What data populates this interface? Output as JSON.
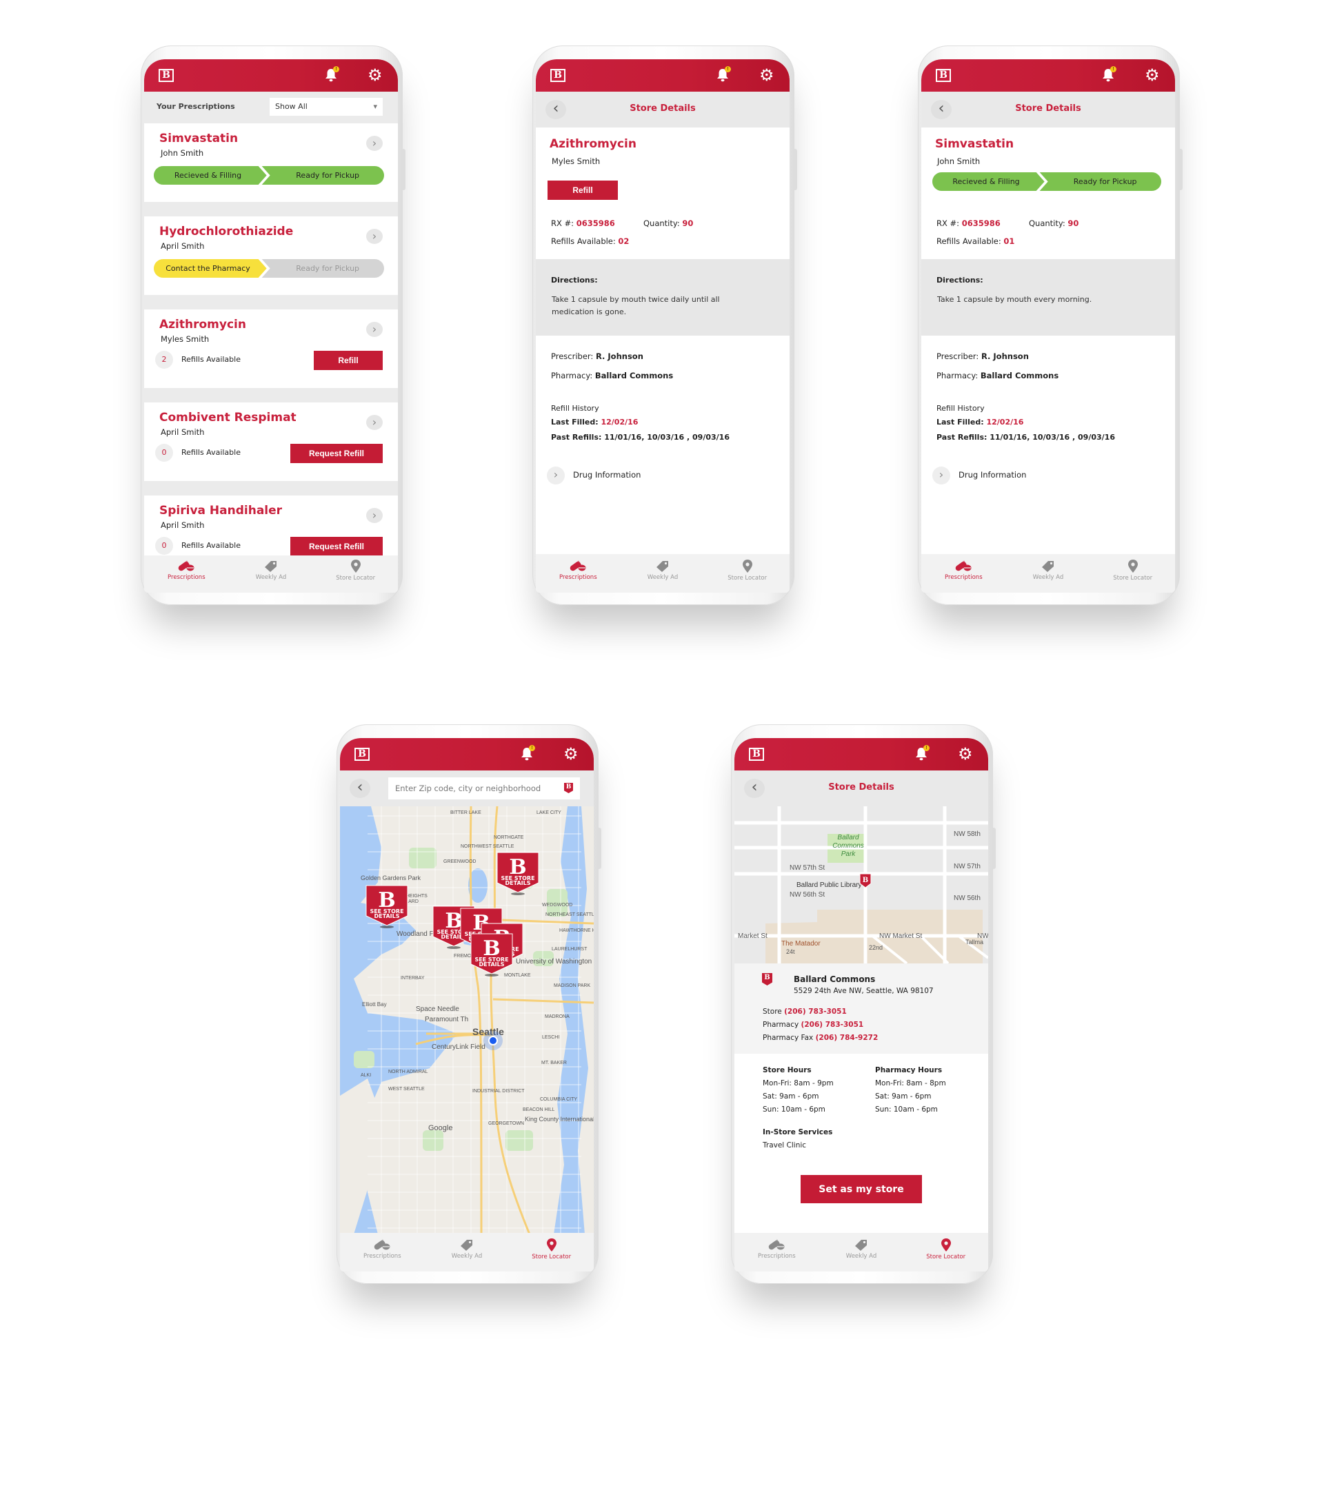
{
  "app": {
    "logo_letter": "B",
    "notification_badge": "!",
    "brand_color": "#c41c35",
    "status_green": "#7cc24e",
    "status_yellow": "#f7e03c",
    "status_gray": "#d4d4d4"
  },
  "nav": {
    "items": [
      {
        "label": "Prescriptions",
        "icon": "pills-icon"
      },
      {
        "label": "Weekly Ad",
        "icon": "tag-icon"
      },
      {
        "label": "Store Locator",
        "icon": "map-pin-icon"
      }
    ]
  },
  "screens": {
    "prescriptions": {
      "title": "Your Prescriptions",
      "filter": "Show All",
      "active_nav": "Prescriptions",
      "items": [
        {
          "drug": "Simvastatin",
          "patient": "John Smith",
          "steps": [
            "Recieved & Filling",
            "Ready for Pickup"
          ],
          "step_colors": [
            "green",
            "green"
          ]
        },
        {
          "drug": "Hydrochlorothiazide",
          "patient": "April Smith",
          "steps": [
            "Contact the Pharmacy",
            "Ready for Pickup"
          ],
          "step_colors": [
            "yellow",
            "gray"
          ]
        },
        {
          "drug": "Azithromycin",
          "patient": "Myles Smith",
          "refills": "2",
          "refills_label": "Refills Available",
          "action": "Refill"
        },
        {
          "drug": "Combivent Respimat",
          "patient": "April Smith",
          "refills": "0",
          "refills_label": "Refills Available",
          "action": "Request Refill"
        },
        {
          "drug": "Spiriva Handihaler",
          "patient": "April Smith",
          "refills": "0",
          "refills_label": "Refills Available",
          "action": "Request Refill"
        }
      ]
    },
    "detail_azithromycin": {
      "title": "Store Details",
      "drug": "Azithromycin",
      "patient": "Myles Smith",
      "action": "Refill",
      "rx_label": "RX #:",
      "rx": "0635986",
      "qty_label": "Quantity:",
      "qty": "90",
      "refills_label": "Refills Available:",
      "refills": "02",
      "directions_label": "Directions:",
      "directions": "Take 1 capsule by mouth twice daily until all medication is gone.",
      "prescriber_label": "Prescriber:",
      "prescriber": "R. Johnson",
      "pharmacy_label": "Pharmacy:",
      "pharmacy": "Ballard Commons",
      "history_label": "Refill History",
      "last_label": "Last Filled:",
      "last": "12/02/16",
      "past_label": "Past Refills:",
      "past": "11/01/16, 10/03/16 , 09/03/16",
      "drug_info": "Drug Information",
      "active_nav": "Prescriptions"
    },
    "detail_simvastatin": {
      "title": "Store Details",
      "drug": "Simvastatin",
      "patient": "John Smith",
      "steps": [
        "Recieved & Filling",
        "Ready for Pickup"
      ],
      "step_colors": [
        "green",
        "green"
      ],
      "rx_label": "RX #:",
      "rx": "0635986",
      "qty_label": "Quantity:",
      "qty": "90",
      "refills_label": "Refills Available:",
      "refills": "01",
      "directions_label": "Directions:",
      "directions": "Take 1 capsule by mouth every morning.",
      "prescriber_label": "Prescriber:",
      "prescriber": "R. Johnson",
      "pharmacy_label": "Pharmacy:",
      "pharmacy": "Ballard Commons",
      "history_label": "Refill History",
      "last_label": "Last Filled:",
      "last": "12/02/16",
      "past_label": "Past Refills:",
      "past": "11/01/16, 10/03/16 , 09/03/16",
      "drug_info": "Drug Information",
      "active_nav": "Prescriptions"
    },
    "store_locator": {
      "search_placeholder": "Enter Zip code, city or neighborhood",
      "pin_line1": "SEE STORE",
      "pin_line2": "DETAILS",
      "map_labels": [
        "BITTER LAKE",
        "LAKE CITY",
        "NORTHGATE",
        "NORTHWEST SEATTLE",
        "GREENWOOD",
        "Golden Gardens Park",
        "LOYAL HEIGHTS",
        "BALLARD",
        "PHINNEY RIDGE",
        "WEDGWOOD",
        "NORTHEAST SEATTLE",
        "HAWTHORNE HILLS",
        "Woodland Park Zoo",
        "LAURELHURST",
        "FREMONT",
        "University of Washington",
        "INTERBAY",
        "MONTLAKE",
        "MADISON PARK",
        "Space Needle",
        "Paramount Th",
        "MADRONA",
        "Seattle",
        "LESCHI",
        "CenturyLink Field",
        "MT. BAKER",
        "ALKI",
        "NORTH ADMIRAL",
        "WEST SEATTLE",
        "INDUSTRIAL DISTRICT",
        "COLUMBIA CITY",
        "BEACON HILL",
        "GEORGETOWN",
        "King County International Airport",
        "Elliott Bay",
        "Google"
      ],
      "active_nav": "Store Locator"
    },
    "store_details": {
      "title": "Store Details",
      "map_labels": [
        "Ballard",
        "Commons",
        "Park",
        "NW 57th St",
        "Ballard Public Library",
        "NW 56th St",
        "Market St",
        "The Matador",
        "NW Market St",
        "NW 58th",
        "NW 57th",
        "NW 56th",
        "NW",
        "22nd",
        "24t",
        "Tallma"
      ],
      "store_name": "Ballard Commons",
      "address": "5529 24th Ave NW, Seattle, WA 98107",
      "store_phone_label": "Store",
      "store_phone": "(206) 783-3051",
      "pharmacy_phone_label": "Pharmacy",
      "pharmacy_phone": "(206) 783-3051",
      "fax_label": "Pharmacy Fax",
      "fax": "(206) 784-9272",
      "store_hours_label": "Store Hours",
      "store_hours": [
        "Mon-Fri: 8am - 9pm",
        "Sat: 9am - 6pm",
        "Sun: 10am - 6pm"
      ],
      "pharmacy_hours_label": "Pharmacy Hours",
      "pharmacy_hours": [
        "Mon-Fri: 8am - 8pm",
        "Sat: 9am - 6pm",
        "Sun: 10am - 6pm"
      ],
      "services_label": "In-Store Services",
      "services": [
        "Travel Clinic"
      ],
      "cta": "Set as my store",
      "active_nav": "Store Locator"
    }
  }
}
